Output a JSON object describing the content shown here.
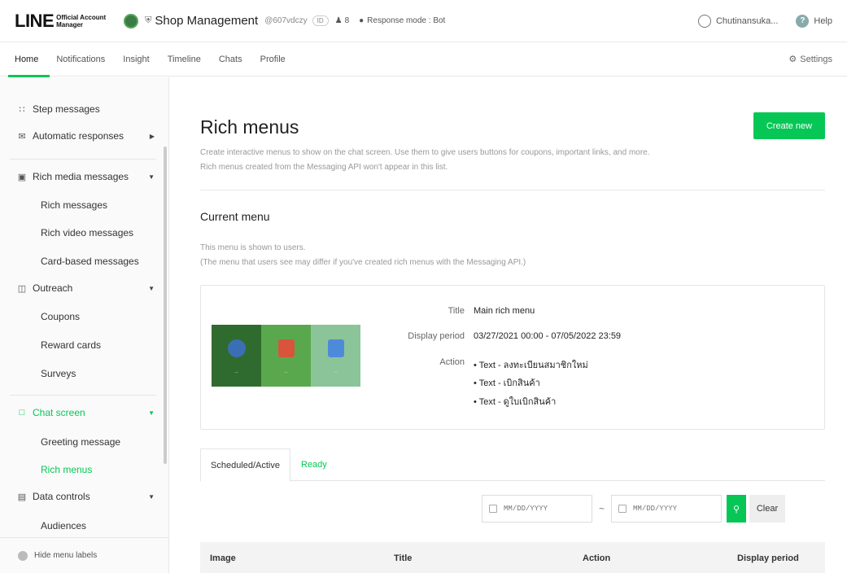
{
  "topbar": {
    "logo_main": "LINE",
    "logo_sub_1": "Official Account",
    "logo_sub_2": "Manager",
    "shop_name": "Shop Management",
    "shop_id": "@607vdczy",
    "id_badge": "ID",
    "friends_count": "8",
    "response_mode": "Response mode : Bot",
    "user_name": "Chutinansuka...",
    "help": "Help"
  },
  "nav": {
    "tabs": [
      "Home",
      "Notifications",
      "Insight",
      "Timeline",
      "Chats",
      "Profile"
    ],
    "settings": "Settings"
  },
  "sidebar": {
    "step_messages": "Step messages",
    "automatic_responses": "Automatic responses",
    "rich_media_messages": "Rich media messages",
    "rich_messages": "Rich messages",
    "rich_video_messages": "Rich video messages",
    "card_based_messages": "Card-based messages",
    "outreach": "Outreach",
    "coupons": "Coupons",
    "reward_cards": "Reward cards",
    "surveys": "Surveys",
    "chat_screen": "Chat screen",
    "greeting_message": "Greeting message",
    "rich_menus": "Rich menus",
    "data_controls": "Data controls",
    "audiences": "Audiences",
    "hide_labels": "Hide menu labels"
  },
  "main": {
    "title": "Rich menus",
    "create_button": "Create new",
    "desc_line1": "Create interactive menus to show on the chat screen. Use them to give users buttons for coupons, important links, and more.",
    "desc_line2": "Rich menus created from the Messaging API won't appear in this list.",
    "current_menu": "Current menu",
    "note_line1": "This menu is shown to users.",
    "note_line2": "(The menu that users see may differ if you've created rich menus with the Messaging API.)",
    "card": {
      "title_label": "Title",
      "title_value": "Main rich menu",
      "period_label": "Display period",
      "period_value": "03/27/2021 00:00 - 07/05/2022 23:59",
      "action_label": "Action",
      "actions": [
        "• Text - ลงทะเบียนสมาชิกใหม่",
        "• Text - เบิกสินค้า",
        "• Text - ดูใบเบิกสินค้า"
      ]
    },
    "tabs": {
      "active": "Scheduled/Active",
      "ready": "Ready"
    },
    "filter": {
      "placeholder_start": "MM/DD/YYYY",
      "placeholder_end": "MM/DD/YYYY",
      "tilde": "~",
      "clear": "Clear"
    },
    "table_headers": [
      "Image",
      "Title",
      "Action",
      "Display period"
    ]
  },
  "colors": {
    "accent": "#06c755"
  }
}
